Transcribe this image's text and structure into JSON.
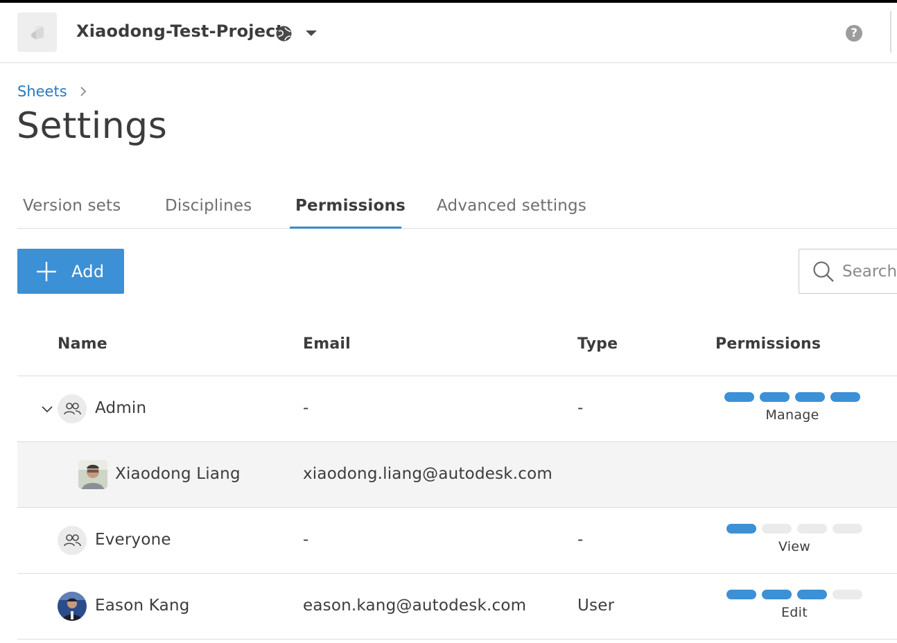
{
  "header": {
    "project_name": "Xiaodong-Test-Project",
    "help_glyph": "?"
  },
  "breadcrumb": {
    "link": "Sheets"
  },
  "page_title": "Settings",
  "tabs": [
    {
      "label": "Version sets"
    },
    {
      "label": "Disciplines"
    },
    {
      "label": "Permissions"
    },
    {
      "label": "Advanced settings"
    }
  ],
  "active_tab": "Permissions",
  "toolbar": {
    "add_label": "Add",
    "search_placeholder": "Search"
  },
  "table": {
    "columns": [
      "Name",
      "Email",
      "Type",
      "Permissions"
    ],
    "rows": [
      {
        "name": "Admin",
        "email": "-",
        "type": "-",
        "permission": "Manage",
        "level": 4,
        "kind": "group",
        "expanded": true
      },
      {
        "name": "Xiaodong Liang",
        "email": "xiaodong.liang@autodesk.com",
        "type": "",
        "permission": "",
        "level": 0,
        "kind": "user",
        "child": true
      },
      {
        "name": "Everyone",
        "email": "-",
        "type": "-",
        "permission": "View",
        "level": 1,
        "kind": "group"
      },
      {
        "name": "Eason Kang",
        "email": "eason.kang@autodesk.com",
        "type": "User",
        "permission": "Edit",
        "level": 3,
        "kind": "user"
      }
    ]
  },
  "colors": {
    "accent": "#3c90d6",
    "link": "#2b78bd",
    "bar_off": "#ebebeb"
  },
  "icons": {
    "app": "app-logo-icon",
    "globe": "globe-icon",
    "dropdown": "caret-down-icon",
    "help": "help-icon",
    "chevron_right": "chevron-right-icon",
    "plus": "plus-icon",
    "search": "search-icon",
    "group": "group-icon",
    "chevron_down": "chevron-down-icon"
  }
}
